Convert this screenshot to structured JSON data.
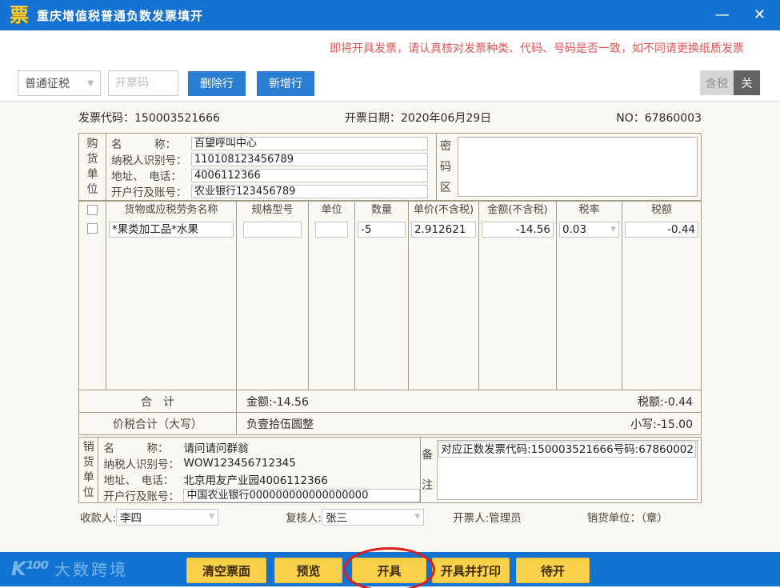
{
  "window": {
    "title": "重庆增值税普通负数发票填开",
    "icon_glyph": "票",
    "minimize_glyph": "—",
    "close_glyph": "✕"
  },
  "notice": "即将开具发票，请认真核对发票种类、代码、号码是否一致，如不同请更换纸质发票",
  "toolbar": {
    "tax_type": "普通征税",
    "invoice_code_placeholder": "开票码",
    "delete_row": "删除行",
    "add_row": "新增行",
    "tax_included": "含税",
    "tax_off": "关"
  },
  "invoice_meta": {
    "code_label": "发票代码：",
    "code": "150003521666",
    "date_label": "开票日期：",
    "date": "2020年06月29日",
    "no_label": "NO：",
    "no": "67860003"
  },
  "buyer": {
    "section_label": "购货单位",
    "rows": [
      {
        "label": "名　　　称：",
        "value": "百望呼叫中心"
      },
      {
        "label": "纳税人识别号：",
        "value": "110108123456789"
      },
      {
        "label": "地址、　电话：",
        "value": "4006112366"
      },
      {
        "label": "开户行及账号：",
        "value": "农业银行123456789"
      }
    ],
    "password_label": "密码区"
  },
  "items": {
    "headers": [
      "货物或应税劳务名称",
      "规格型号",
      "单位",
      "数量",
      "单价(不含税)",
      "金额(不含税)",
      "税率",
      "税额"
    ],
    "row": {
      "name": "*果类加工品*水果",
      "spec": "",
      "unit": "",
      "quantity": "-5",
      "unit_price": "2.912621",
      "amount": "-14.56",
      "tax_rate": "0.03",
      "tax": "-0.44"
    }
  },
  "totals": {
    "label": "合　计",
    "amount": "金额:-14.56",
    "tax": "税额:-0.44"
  },
  "grand_total": {
    "label": "价税合计（大写）",
    "words": "负壹拾伍圆整",
    "numeric": "小写:-15.00"
  },
  "seller": {
    "section_label": "销货单位",
    "rows": [
      {
        "label": "名　　　称：",
        "value": "请问请问群翁"
      },
      {
        "label": "纳税人识别号：",
        "value": "WOW123456712345"
      },
      {
        "label": "地址、　电话：",
        "value": "北京用友产业园4006112366"
      },
      {
        "label": "开户行及账号：",
        "value": "中国农业银行000000000000000000"
      }
    ],
    "remark_label": "备注",
    "remark": "对应正数发票代码:150003521666号码:67860002"
  },
  "signers": {
    "payee_label": "收款人:",
    "payee": "李四",
    "reviewer_label": "复核人:",
    "reviewer": "张三",
    "issuer": "开票人:管理员",
    "seller_seal": "销货单位：（章）"
  },
  "footer": {
    "logo_mark": "K¹⁰⁰",
    "logo_text": "大数跨境",
    "buttons": {
      "clear": "清空票面",
      "preview": "预览",
      "issue": "开具",
      "issue_print": "开具并打印",
      "pending": "待开"
    }
  },
  "icons": {
    "dropdown_arrow": "▼"
  },
  "colors": {
    "titlebar_blue": "#1472d2",
    "button_blue": "#2b7cd3",
    "warning_red": "#e25555",
    "footer_button_yellow": "#fbd14b",
    "annotation_red": "#dd1d17",
    "form_background": "#faf8f3"
  }
}
